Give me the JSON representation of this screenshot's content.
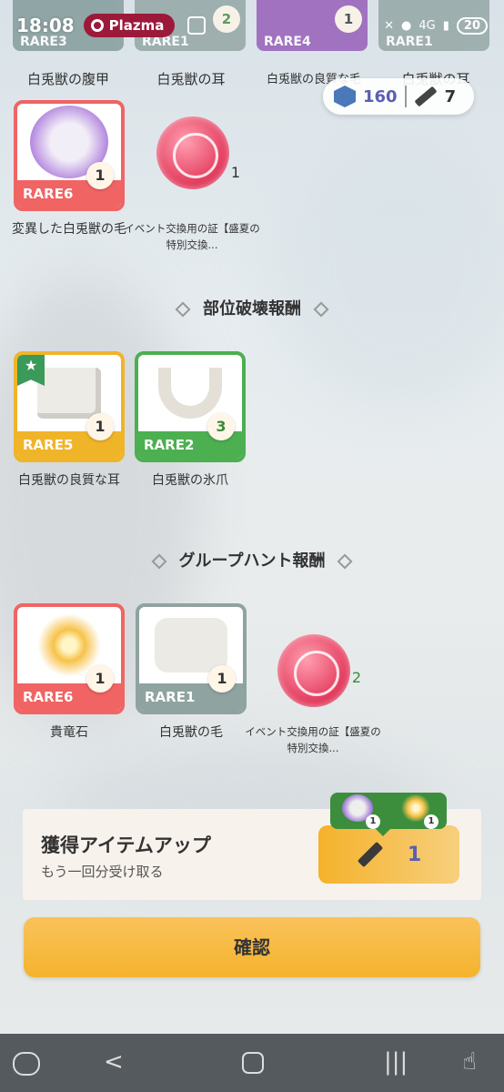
{
  "status_bar": {
    "time": "18:08",
    "plazma": "Plazma",
    "network": "4G",
    "battery": "20"
  },
  "top_row": [
    {
      "rare": "RARE3",
      "color": "#7f9896",
      "count": "",
      "name": "白兎獣の腹甲"
    },
    {
      "rare": "RARE1",
      "color": "#8fa3a0",
      "count": "2",
      "name": "白兎獣の耳"
    },
    {
      "rare": "RARE4",
      "color": "#9257b5",
      "count": "1",
      "name": "白兎獣の良質な毛"
    },
    {
      "rare": "RARE1",
      "color": "#8fa3a0",
      "count": "1",
      "name": "白兎獣の耳"
    }
  ],
  "currency": {
    "gems": "160",
    "knives": "7"
  },
  "items_row1": [
    {
      "rare": "RARE6",
      "count": "1",
      "name": "変異した白兎獣の毛"
    },
    {
      "count": "1",
      "name": "イベント交換用の証【盛夏の特別交換..."
    }
  ],
  "section_break": {
    "title": "部位破壊報酬"
  },
  "items_break": [
    {
      "rare": "RARE5",
      "count": "1",
      "name": "白兎獣の良質な耳"
    },
    {
      "rare": "RARE2",
      "count": "3",
      "name": "白兎獣の氷爪"
    }
  ],
  "section_group": {
    "title": "グループハント報酬"
  },
  "items_group": [
    {
      "rare": "RARE6",
      "count": "1",
      "name": "貴竜石"
    },
    {
      "rare": "RARE1",
      "count": "1",
      "name": "白兎獣の毛"
    },
    {
      "count": "2",
      "name": "イベント交換用の証【盛夏の特別交換..."
    }
  ],
  "bonus": {
    "title": "獲得アイテムアップ",
    "subtitle": "もう一回分受け取る",
    "cost": "1",
    "preview": [
      {
        "count": "1"
      },
      {
        "count": "1"
      }
    ]
  },
  "confirm_label": "確認",
  "colors": {
    "rare1": "#8fa3a0",
    "rare2": "#4caf50",
    "rare5": "#f0b429",
    "rare6": "#f06464",
    "accent": "#f5b32d"
  }
}
